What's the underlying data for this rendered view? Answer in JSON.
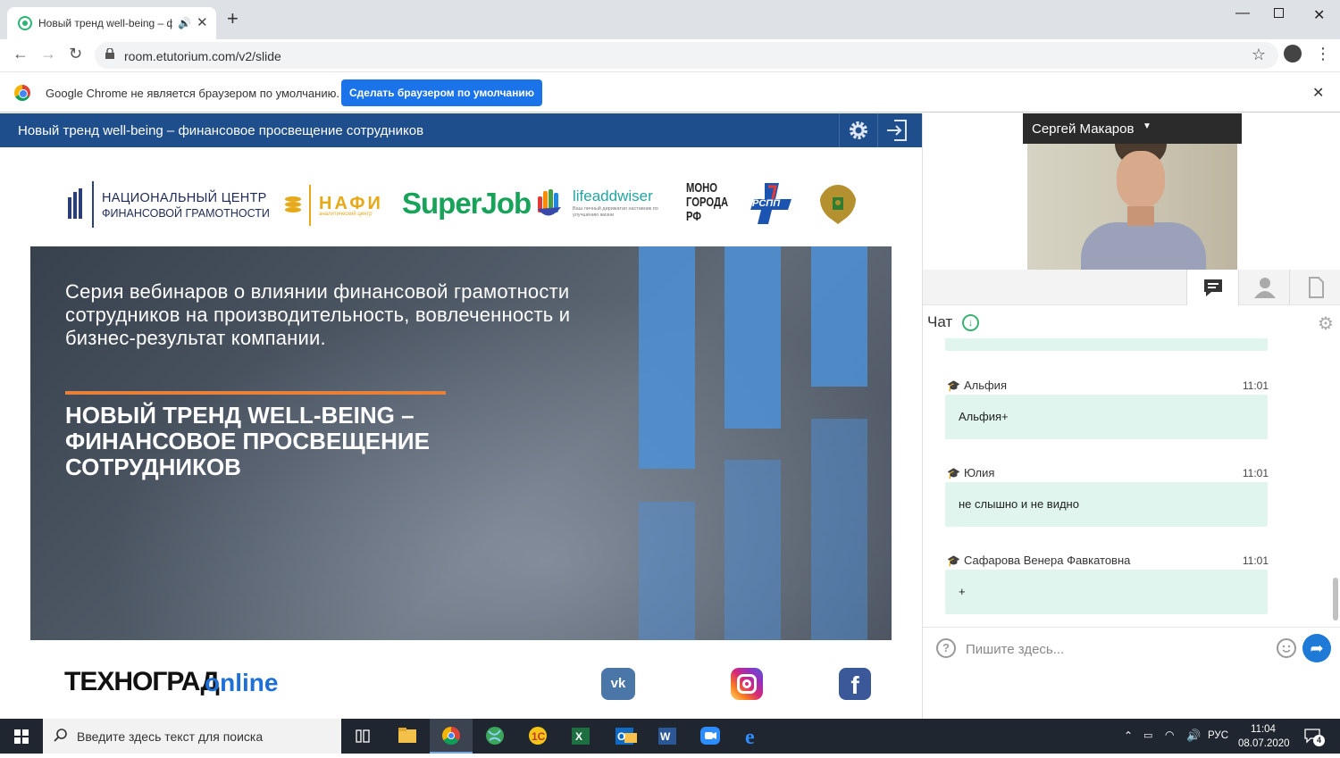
{
  "browser": {
    "tab_title": "Новый тренд well-being – ф",
    "url": "room.etutorium.com/v2/slide",
    "infobar_message": "Google Chrome не является браузером по умолчанию.",
    "infobar_button": "Сделать браузером по умолчанию"
  },
  "page": {
    "header_title": "Новый тренд well-being – финансовое просвещение сотрудников"
  },
  "slide": {
    "logos": {
      "ncfg_line1": "НАЦИОНАЛЬНЫЙ ЦЕНТР",
      "ncfg_line2": "ФИНАНСОВОЙ ГРАМОТНОСТИ",
      "nafi": "НАФИ",
      "nafi_sub": "аналитический центр",
      "superjob": "SuperJob",
      "lifeaddwiser": "lifeaddwiser",
      "lifeaddwiser_sub": "Ваш личный дирижатап наставник по улучшению жизни",
      "mono_line1": "МОНО",
      "mono_line2": "ГОРОДА",
      "mono_line3": "РФ",
      "rspp": "РСПП"
    },
    "subtitle": "Серия вебинаров о влиянии финансовой грамотности сотрудников на производительность, вовлеченность и бизнес-результат компании.",
    "headline": "НОВЫЙ ТРЕНД WELL-BEING – ФИНАНСОВОЕ ПРОСВЕЩЕНИЕ СОТРУДНИКОВ",
    "footer_brand": "ТЕХНОГРАД",
    "footer_brand_online": "online"
  },
  "presenter": {
    "name": "Сергей Макаров"
  },
  "chat": {
    "title": "Чат",
    "messages": [
      {
        "author": "Альфия",
        "time": "11:01",
        "text": "Альфия+"
      },
      {
        "author": "Юлия",
        "time": "11:01",
        "text": "не слышно и не видно"
      },
      {
        "author": "Сафарова Венера Фавкатовна",
        "time": "11:01",
        "text": "+"
      }
    ],
    "input_placeholder": "Пишите здесь..."
  },
  "taskbar": {
    "search_placeholder": "Введите здесь текст для поиска",
    "lang": "РУС",
    "time": "11:04",
    "date": "08.07.2020",
    "notifications": "4"
  }
}
